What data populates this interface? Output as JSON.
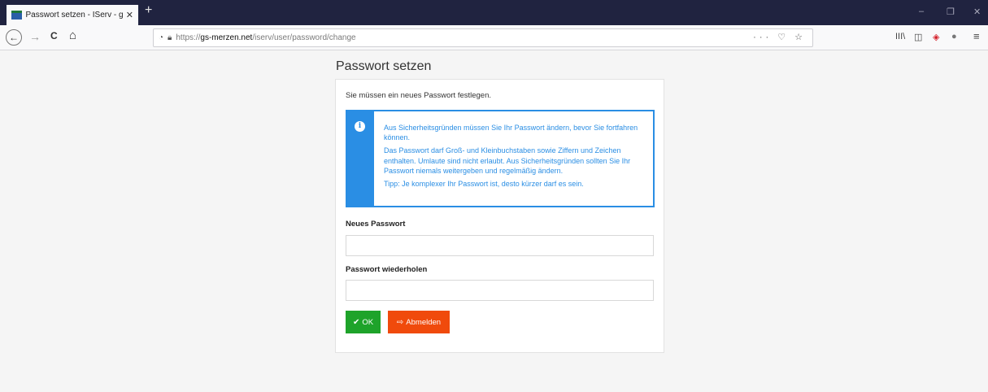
{
  "browser": {
    "tab_title": "Passwort setzen - IServ - gs-me",
    "tab_close": "✕",
    "newtab": "+",
    "window_controls": [
      "–",
      "❐",
      "✕"
    ],
    "nav": {
      "back": "←",
      "forward": "→",
      "reload": "C",
      "home": "⌂"
    },
    "url_prefix": "https://",
    "url_host": "gs-merzen.net",
    "url_path": "/iserv/user/password/change",
    "url_actions": "··· ♡ ☆",
    "toolbar_icons": [
      "library-icon",
      "sidebar-icon",
      "shield-icon",
      "extension-icon",
      "menu-icon"
    ],
    "toolbar_glyphs": [
      "III\\",
      "◫",
      "◈",
      "●",
      "≡"
    ]
  },
  "page": {
    "title": "Passwort setzen",
    "intro": "Sie müssen ein neues Passwort festlegen.",
    "alert": {
      "p1": "Aus Sicherheitsgründen müssen Sie Ihr Passwort ändern, bevor Sie fortfahren können.",
      "p2": "Das Passwort darf Groß- und Kleinbuchstaben sowie Ziffern und Zeichen enthalten. Umlaute sind nicht erlaubt. Aus Sicherheitsgründen sollten Sie Ihr Passwort niemals weitergeben und regelmäßig ändern.",
      "p3": "Tipp: Je komplexer Ihr Passwort ist, desto kürzer darf es sein."
    },
    "new_password_label": "Neues Passwort",
    "new_password_value": "",
    "repeat_password_label": "Passwort wiederholen",
    "repeat_password_value": "",
    "ok_label": "OK",
    "logout_label": "Abmelden"
  },
  "colors": {
    "info": "#2a8ee4",
    "success": "#1ea32a",
    "danger": "#f04a0c",
    "titlebar": "#202340"
  }
}
